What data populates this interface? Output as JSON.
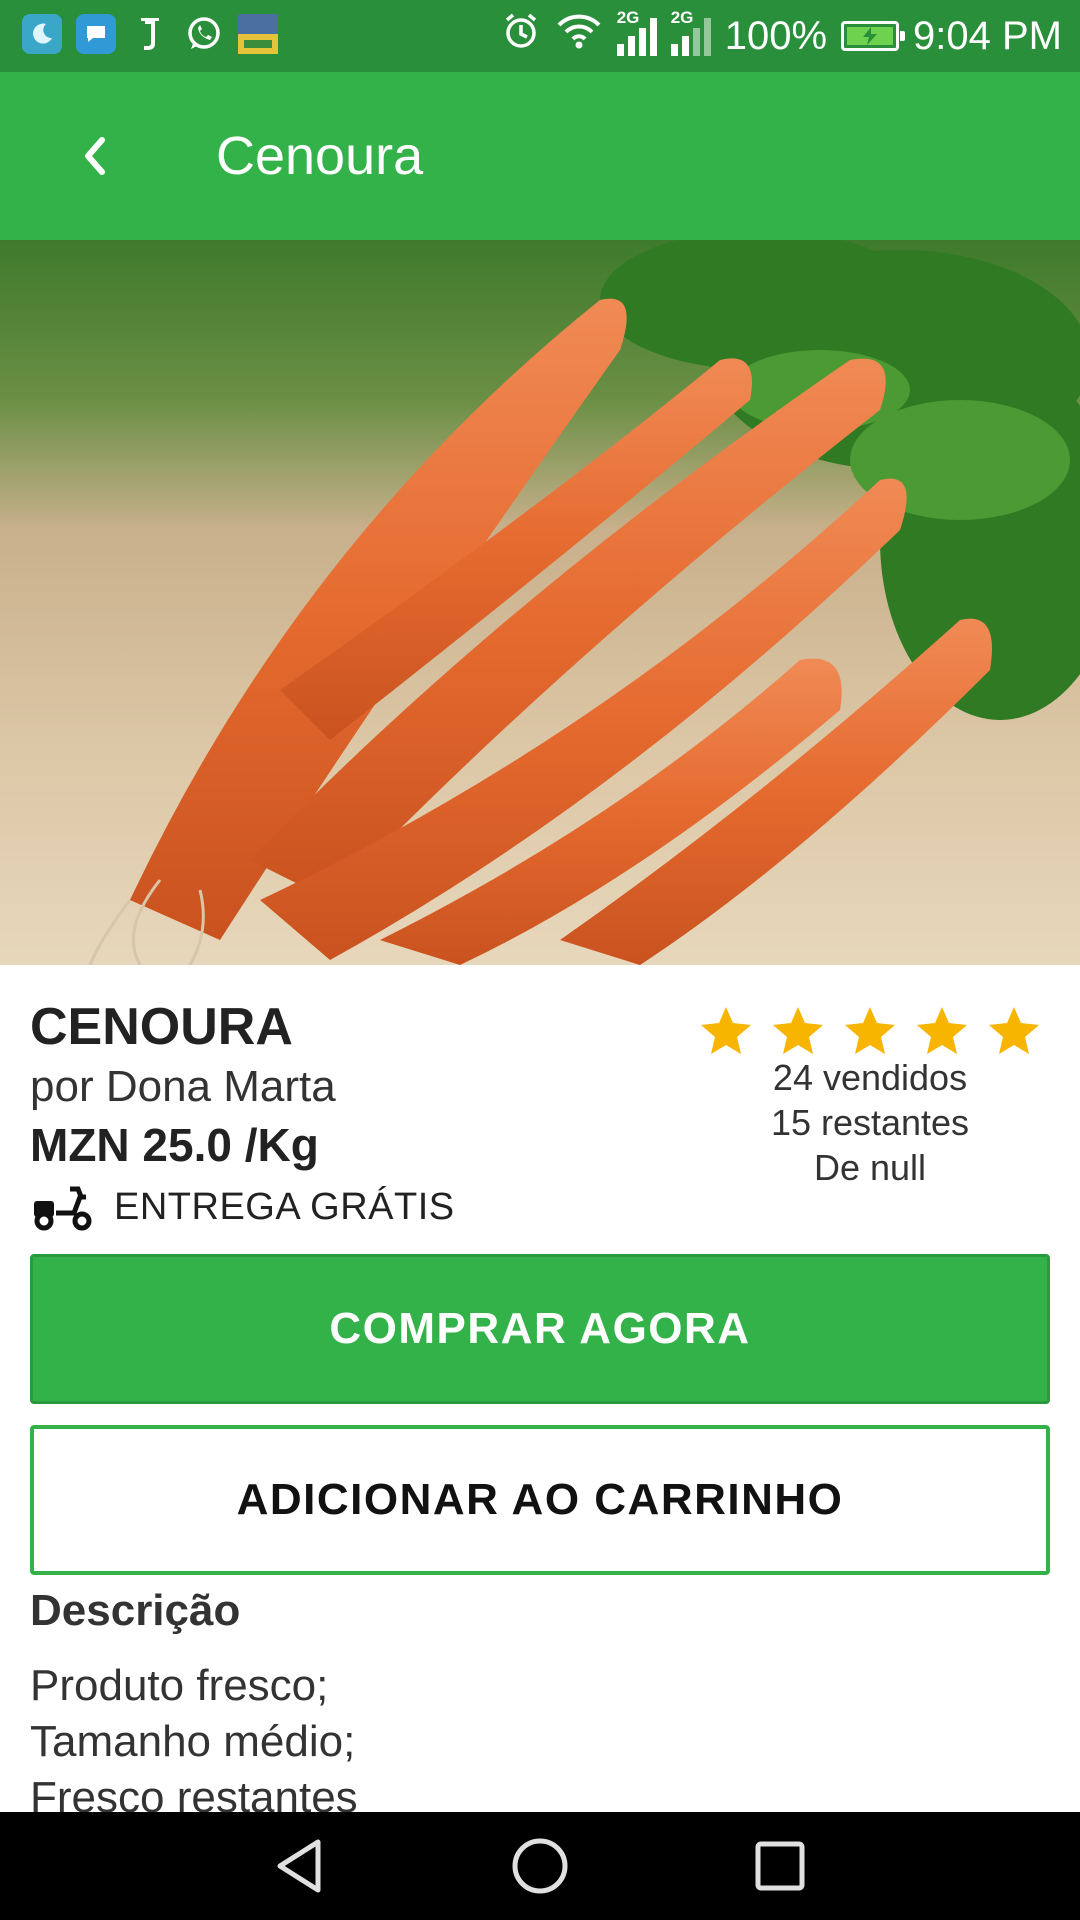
{
  "status_bar": {
    "network_1": "2G",
    "network_2": "2G",
    "battery": "100%",
    "time": "9:04 PM"
  },
  "app_bar": {
    "title": "Cenoura"
  },
  "product": {
    "name": "CENOURA",
    "seller": "por Dona Marta",
    "price": "MZN 25.0 /Kg",
    "delivery": "ENTREGA GRÁTIS",
    "rating": 5,
    "sold": "24 vendidos",
    "remaining": "15 restantes",
    "origin": "De null"
  },
  "actions": {
    "buy_now": "COMPRAR AGORA",
    "add_to_cart": "ADICIONAR AO CARRINHO"
  },
  "description": {
    "title": "Descrição",
    "lines": [
      "Produto fresco;",
      "Tamanho médio;",
      "Fresco restantes"
    ]
  },
  "colors": {
    "status_bar": "#2a8f3a",
    "app_bar": "#34b24a",
    "accent": "#33b24a",
    "star": "#f7b500",
    "nav_bar": "#000000"
  },
  "icons": {
    "back": "arrow-back-icon",
    "delivery": "scooter-icon",
    "rating": "star-icon"
  }
}
